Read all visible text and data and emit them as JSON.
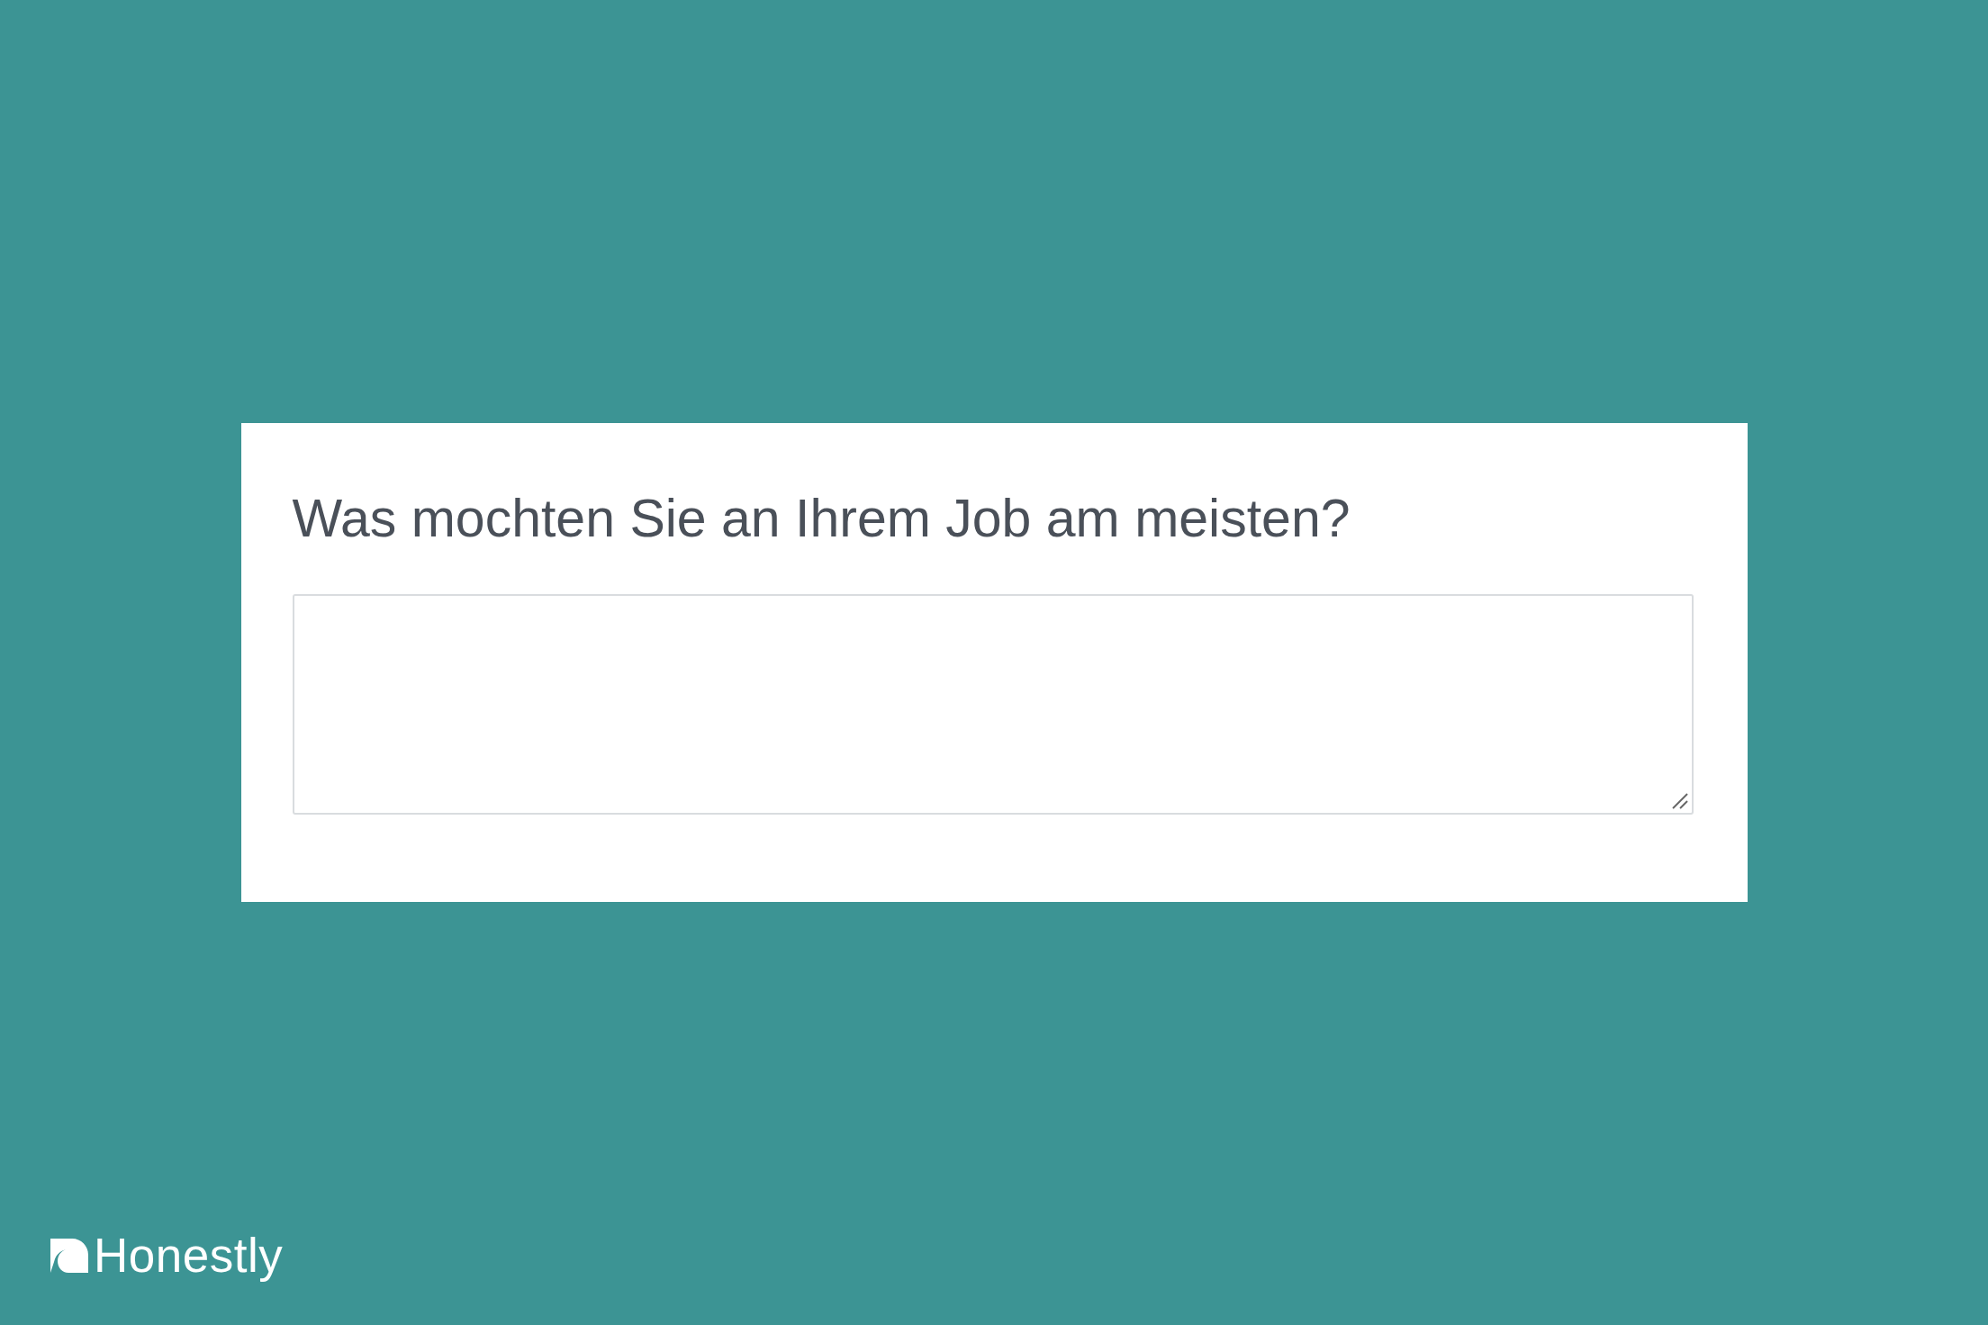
{
  "question": {
    "title": "Was mochten Sie an Ihrem Job am meisten?"
  },
  "answer_field": {
    "resizable": true
  },
  "logo": {
    "text": "Honestly"
  }
}
